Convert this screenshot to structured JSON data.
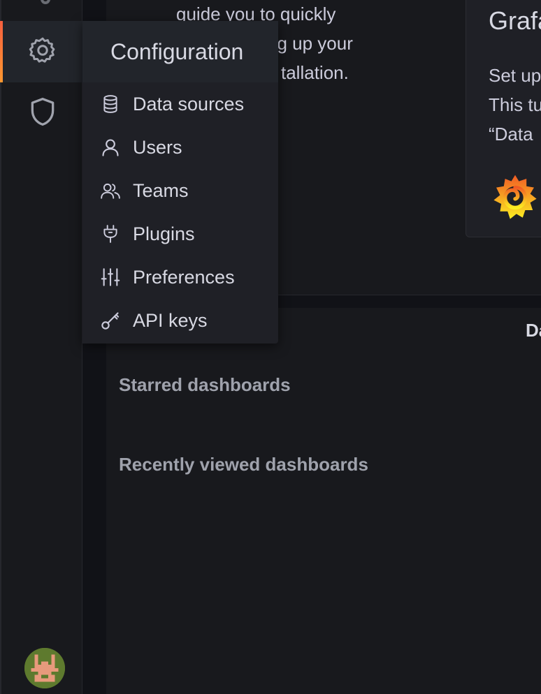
{
  "sidebar": {
    "items": [
      {
        "name": "configuration",
        "icon": "gear-icon",
        "active": true
      },
      {
        "name": "server-admin",
        "icon": "shield-icon",
        "active": false
      }
    ],
    "avatar": "user-avatar"
  },
  "intro": {
    "lines": [
      "guide you to quickly",
      "ng up your",
      "tallation."
    ]
  },
  "tutorial_card": {
    "title": "Grafa",
    "body_lines": [
      "Set up",
      "This tu",
      "“Data"
    ],
    "logo": "grafana-logo-icon"
  },
  "menu": {
    "title": "Configuration",
    "items": [
      {
        "label": "Data sources",
        "icon": "database-icon"
      },
      {
        "label": "Users",
        "icon": "user-icon"
      },
      {
        "label": "Teams",
        "icon": "users-icon"
      },
      {
        "label": "Plugins",
        "icon": "plug-icon"
      },
      {
        "label": "Preferences",
        "icon": "sliders-icon"
      },
      {
        "label": "API keys",
        "icon": "key-icon"
      }
    ]
  },
  "dashboard_panel": {
    "header_fragment": "Da",
    "starred_title": "Starred dashboards",
    "recent_title": "Recently viewed dashboards"
  },
  "colors": {
    "accent_gradient_start": "#f55f3e",
    "accent_gradient_end": "#ff9830",
    "background": "#111217",
    "panel": "#18191d"
  }
}
